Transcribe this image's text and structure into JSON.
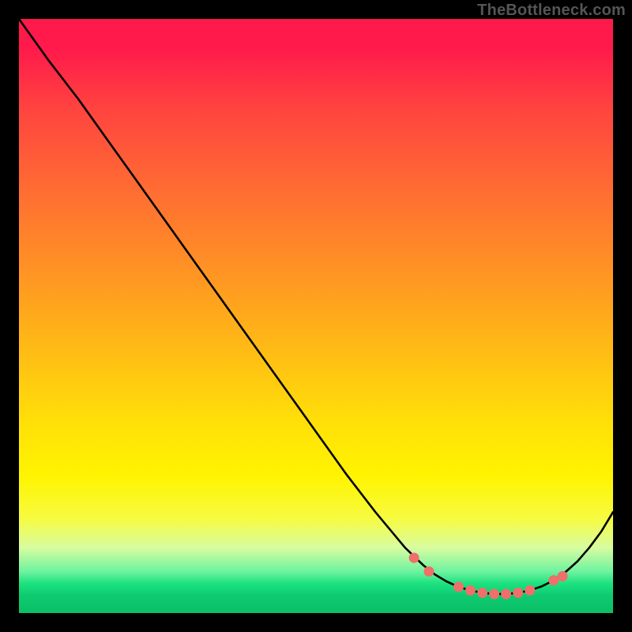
{
  "watermark": "TheBottleneck.com",
  "chart_data": {
    "type": "line",
    "title": "",
    "xlabel": "",
    "ylabel": "",
    "xlim": [
      0,
      100
    ],
    "ylim": [
      0,
      100
    ],
    "grid": false,
    "legend": false,
    "series": [
      {
        "name": "bottleneck-curve",
        "x": [
          0,
          5,
          10,
          15,
          20,
          25,
          30,
          35,
          40,
          45,
          50,
          55,
          60,
          65,
          68,
          70,
          72,
          74,
          76,
          78,
          80,
          82,
          84,
          86,
          88,
          90,
          92,
          94,
          96,
          98,
          100
        ],
        "y": [
          100,
          93,
          86.5,
          79.5,
          72.5,
          65.5,
          58.5,
          51.5,
          44.5,
          37.5,
          30.5,
          23.5,
          17,
          11,
          8.1,
          6.5,
          5.3,
          4.4,
          3.8,
          3.4,
          3.2,
          3.2,
          3.4,
          3.8,
          4.5,
          5.5,
          6.9,
          8.7,
          11,
          13.7,
          17
        ]
      }
    ],
    "markers": {
      "name": "highlight-dots",
      "color": "#ef6f6a",
      "x": [
        66.5,
        69,
        74,
        76,
        78,
        80,
        82,
        84,
        86,
        90,
        91.5
      ],
      "y": [
        9.3,
        7.0,
        4.4,
        3.8,
        3.4,
        3.2,
        3.2,
        3.4,
        3.8,
        5.5,
        6.2
      ]
    },
    "background_gradient": {
      "type": "vertical",
      "stops": [
        {
          "pos": 0.0,
          "color": "#ff1a4b"
        },
        {
          "pos": 0.55,
          "color": "#ffb916"
        },
        {
          "pos": 0.77,
          "color": "#fff400"
        },
        {
          "pos": 0.95,
          "color": "#1de27f"
        },
        {
          "pos": 1.0,
          "color": "#0abf68"
        }
      ]
    }
  }
}
